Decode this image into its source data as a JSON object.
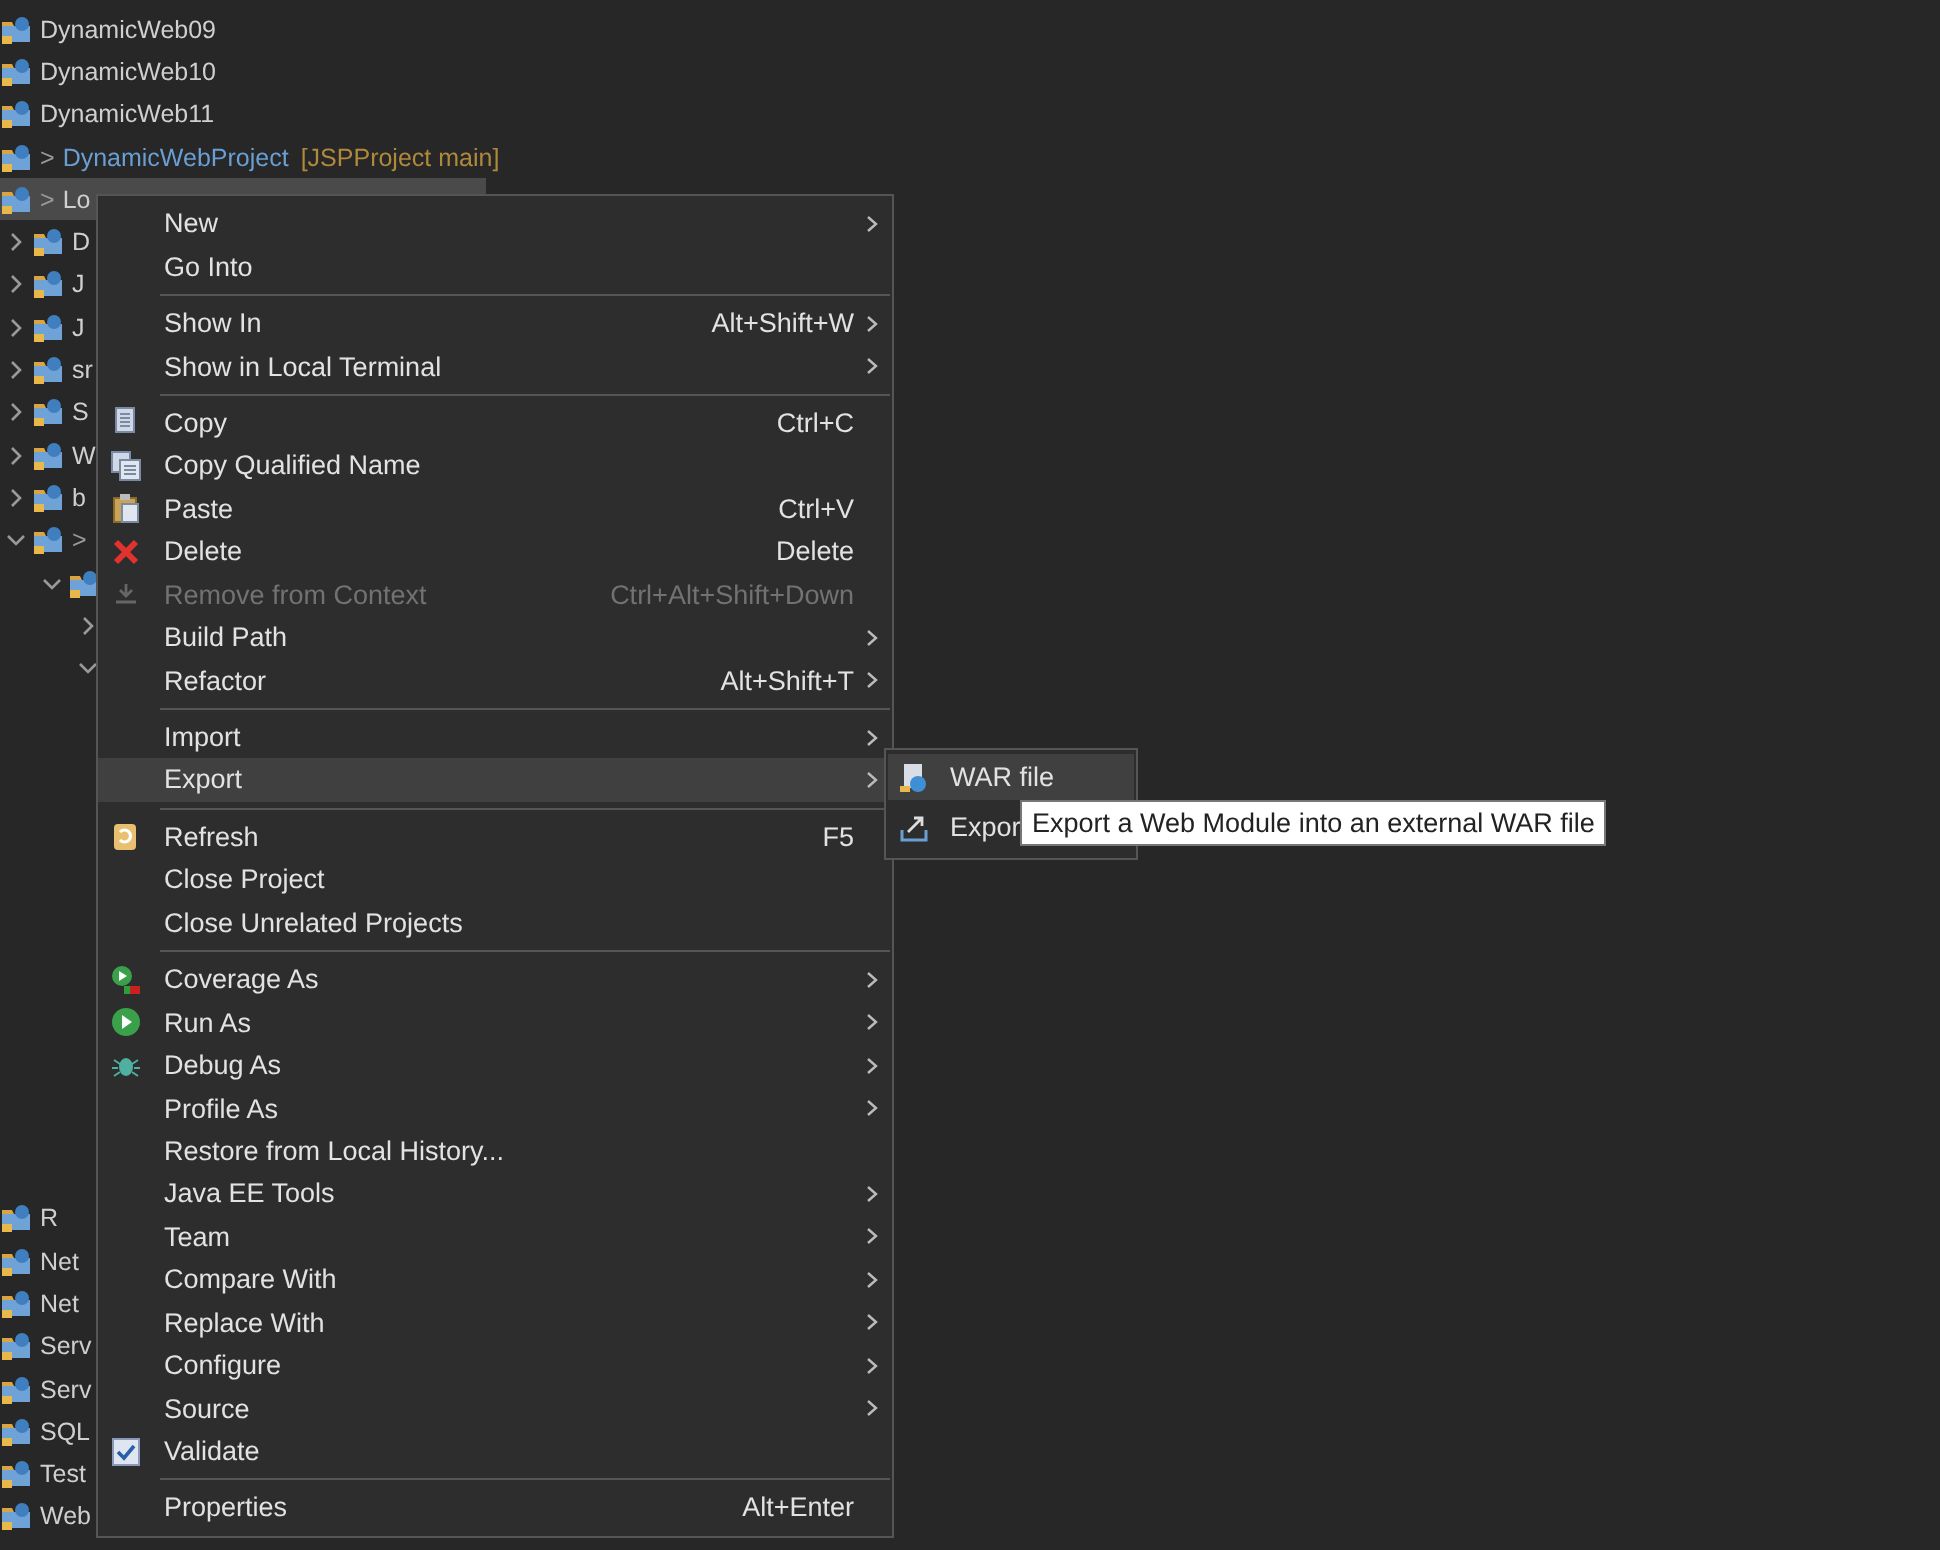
{
  "tree_top": [
    {
      "label": "DynamicWeb09",
      "selected": false
    },
    {
      "label": "DynamicWeb10",
      "selected": false
    },
    {
      "label": "DynamicWeb11",
      "selected": false
    },
    {
      "prefix": ">",
      "label": "DynamicWebProject",
      "branch": "[JSPProject main]",
      "selected": false
    },
    {
      "prefix": ">",
      "label": "Lo",
      "selected": true
    },
    {
      "label": "D",
      "expanded": false,
      "selected": false
    },
    {
      "label": "J",
      "expanded": false,
      "selected": false
    },
    {
      "label": "J",
      "expanded": false,
      "selected": false
    },
    {
      "label": "sr",
      "expanded": false,
      "selected": false
    },
    {
      "label": "S",
      "expanded": false,
      "selected": false
    },
    {
      "label": "W",
      "expanded": false,
      "selected": false
    },
    {
      "label": "b",
      "expanded": false,
      "selected": false
    },
    {
      "prefix": ">",
      "expanded": true,
      "selected": false,
      "children": [
        {
          "expanded": true,
          "selected": false,
          "children": [
            {
              "expanded": false,
              "selected": false
            },
            {
              "expanded": true,
              "selected": false
            }
          ]
        }
      ]
    }
  ],
  "tree_bottom": [
    {
      "label": "R",
      "selected": false
    },
    {
      "label": "Net",
      "selected": false
    },
    {
      "label": "Net",
      "selected": false
    },
    {
      "label": "Serv",
      "selected": false
    },
    {
      "label": "Serv",
      "selected": false
    },
    {
      "label": "SQL",
      "selected": false
    },
    {
      "label": "Test",
      "selected": false
    },
    {
      "label": "Web",
      "selected": false
    }
  ],
  "menu": {
    "items": [
      {
        "kind": "item",
        "label": "New",
        "submenu": true,
        "selected": false,
        "disabled": false,
        "checked": false
      },
      {
        "kind": "item",
        "label": "Go Into",
        "submenu": false,
        "selected": false,
        "disabled": false,
        "checked": false
      },
      {
        "kind": "separator"
      },
      {
        "kind": "item",
        "label": "Show In",
        "shortcut": "Alt+Shift+W",
        "submenu": true,
        "selected": false,
        "disabled": false,
        "checked": false
      },
      {
        "kind": "item",
        "label": "Show in Local Terminal",
        "submenu": true,
        "selected": false,
        "disabled": false,
        "checked": false
      },
      {
        "kind": "separator"
      },
      {
        "kind": "item",
        "label": "Copy",
        "shortcut": "Ctrl+C",
        "submenu": false,
        "selected": false,
        "disabled": false,
        "checked": false
      },
      {
        "kind": "item",
        "label": "Copy Qualified Name",
        "submenu": false,
        "selected": false,
        "disabled": false,
        "checked": false
      },
      {
        "kind": "item",
        "label": "Paste",
        "shortcut": "Ctrl+V",
        "submenu": false,
        "selected": false,
        "disabled": false,
        "checked": false
      },
      {
        "kind": "item",
        "label": "Delete",
        "shortcut": "Delete",
        "submenu": false,
        "selected": false,
        "disabled": false,
        "checked": false
      },
      {
        "kind": "item",
        "label": "Remove from Context",
        "shortcut": "Ctrl+Alt+Shift+Down",
        "submenu": false,
        "selected": false,
        "disabled": true,
        "checked": false
      },
      {
        "kind": "item",
        "label": "Build Path",
        "submenu": true,
        "selected": false,
        "disabled": false,
        "checked": false
      },
      {
        "kind": "item",
        "label": "Refactor",
        "shortcut": "Alt+Shift+T",
        "submenu": true,
        "selected": false,
        "disabled": false,
        "checked": false
      },
      {
        "kind": "separator"
      },
      {
        "kind": "item",
        "label": "Import",
        "submenu": true,
        "selected": false,
        "disabled": false,
        "checked": false
      },
      {
        "kind": "item",
        "label": "Export",
        "submenu": true,
        "selected": true,
        "disabled": false,
        "checked": false
      },
      {
        "kind": "separator"
      },
      {
        "kind": "item",
        "label": "Refresh",
        "shortcut": "F5",
        "submenu": false,
        "selected": false,
        "disabled": false,
        "checked": false
      },
      {
        "kind": "item",
        "label": "Close Project",
        "submenu": false,
        "selected": false,
        "disabled": false,
        "checked": false
      },
      {
        "kind": "item",
        "label": "Close Unrelated Projects",
        "submenu": false,
        "selected": false,
        "disabled": false,
        "checked": false
      },
      {
        "kind": "separator"
      },
      {
        "kind": "item",
        "label": "Coverage As",
        "submenu": true,
        "selected": false,
        "disabled": false,
        "checked": false
      },
      {
        "kind": "item",
        "label": "Run As",
        "submenu": true,
        "selected": false,
        "disabled": false,
        "checked": false
      },
      {
        "kind": "item",
        "label": "Debug As",
        "submenu": true,
        "selected": false,
        "disabled": false,
        "checked": false
      },
      {
        "kind": "item",
        "label": "Profile As",
        "submenu": true,
        "selected": false,
        "disabled": false,
        "checked": false
      },
      {
        "kind": "item",
        "label": "Restore from Local History...",
        "submenu": false,
        "selected": false,
        "disabled": false,
        "checked": false
      },
      {
        "kind": "item",
        "label": "Java EE Tools",
        "submenu": true,
        "selected": false,
        "disabled": false,
        "checked": false
      },
      {
        "kind": "item",
        "label": "Team",
        "submenu": true,
        "selected": false,
        "disabled": false,
        "checked": false
      },
      {
        "kind": "item",
        "label": "Compare With",
        "submenu": true,
        "selected": false,
        "disabled": false,
        "checked": false
      },
      {
        "kind": "item",
        "label": "Replace With",
        "submenu": true,
        "selected": false,
        "disabled": false,
        "checked": false
      },
      {
        "kind": "item",
        "label": "Configure",
        "submenu": true,
        "selected": false,
        "disabled": false,
        "checked": false
      },
      {
        "kind": "item",
        "label": "Source",
        "submenu": true,
        "selected": false,
        "disabled": false,
        "checked": false
      },
      {
        "kind": "item",
        "label": "Validate",
        "submenu": false,
        "selected": false,
        "disabled": false,
        "checked": true
      },
      {
        "kind": "separator"
      },
      {
        "kind": "item",
        "label": "Properties",
        "shortcut": "Alt+Enter",
        "submenu": false,
        "selected": false,
        "disabled": false,
        "checked": false
      }
    ]
  },
  "submenu": {
    "items": [
      {
        "label": "WAR file",
        "selected": true
      },
      {
        "label": "Expor",
        "selected": false
      }
    ]
  },
  "tooltip": {
    "text": "Export a Web Module into an external WAR file"
  }
}
